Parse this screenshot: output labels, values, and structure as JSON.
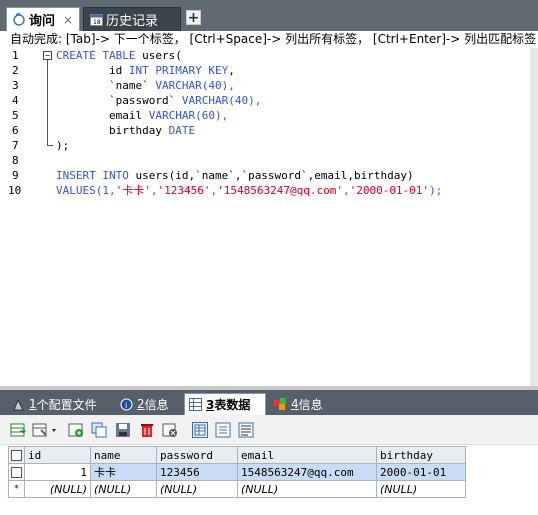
{
  "tabs": {
    "query_label": "询问",
    "history_label": "历史记录",
    "close": "×",
    "add": "+"
  },
  "hint": "自动完成: [Tab]-> 下一个标签， [Ctrl+Space]-> 列出所有标签， [Ctrl+Enter]-> 列出匹配标签",
  "editor": {
    "line_numbers": [
      "1",
      "2",
      "3",
      "4",
      "5",
      "6",
      "7",
      "8",
      "9",
      "10"
    ],
    "lines": [
      {
        "kw1": "CREATE TABLE",
        "txt": " users("
      },
      {
        "txt": "        id ",
        "kw1": "INT PRIMARY KEY",
        ",": ","
      },
      {
        "txt": "        `name` ",
        "kw1": "VARCHAR",
        "rest": "(40),"
      },
      {
        "txt": "        `password` ",
        "kw1": "VARCHAR",
        "rest": "(40),"
      },
      {
        "txt": "        email ",
        "kw1": "VARCHAR",
        "rest": "(60),"
      },
      {
        "txt": "        birthday ",
        "kw1": "DATE"
      },
      {
        "txt": ");"
      },
      {
        "txt": ""
      },
      {
        "kw1": "INSERT INTO",
        "txt": " users(id,`name`,`password`,email,birthday)"
      },
      {
        "kw1": "VALUES",
        "txt": "(1,",
        "s1": "'卡卡'",
        "c1": ",",
        "s2": "'123456'",
        "c2": ",",
        "s3": "'1548563247@qq.com'",
        "c3": ",",
        "s4": "'2000-01-01'",
        "end": ");"
      }
    ]
  },
  "result_tabs": [
    {
      "num": "1",
      "label": " 个配置文件"
    },
    {
      "num": "2",
      "label": " 信息"
    },
    {
      "num": "3",
      "label": " 表数据"
    },
    {
      "num": "4",
      "label": " 信息"
    }
  ],
  "grid": {
    "columns": [
      "id",
      "name",
      "password",
      "email",
      "birthday"
    ],
    "rows": [
      [
        "1",
        "卡卡",
        "123456",
        "1548563247@qq.com",
        "2000-01-01"
      ]
    ],
    "new_row_marker": "*",
    "null_text": "(NULL)"
  },
  "colors": {
    "keyword": "#3455e0",
    "string": "#e0001b",
    "tabbar": "#5f6a73",
    "selected_row": "#c9dcf5"
  }
}
